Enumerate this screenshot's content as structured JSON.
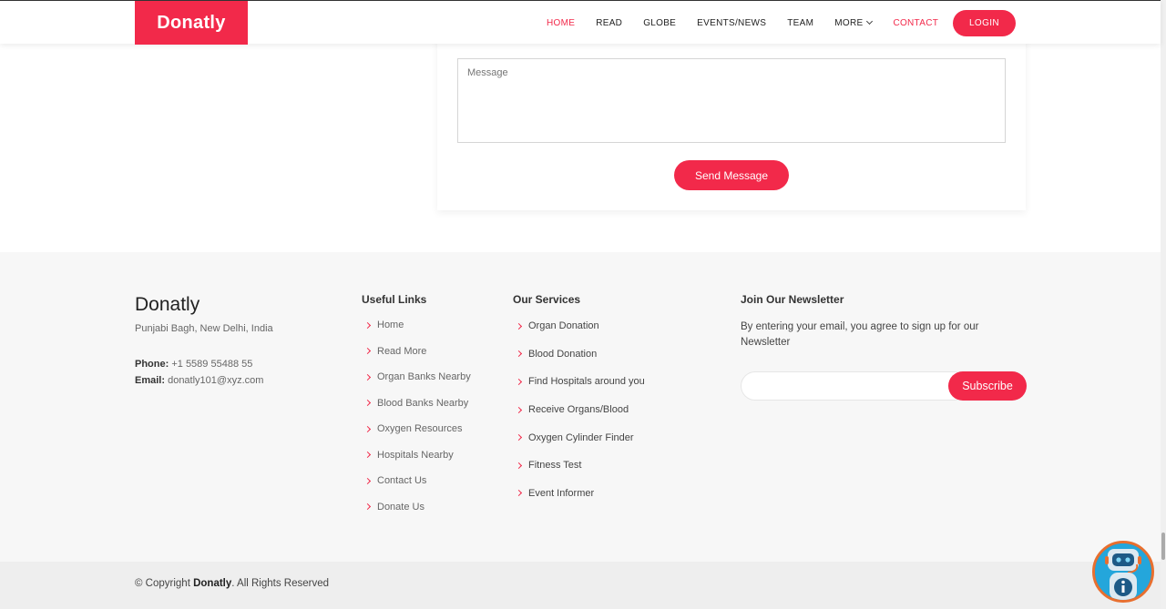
{
  "header": {
    "logo": "Donatly",
    "nav": [
      {
        "label": "HOME"
      },
      {
        "label": "READ"
      },
      {
        "label": "GLOBE"
      },
      {
        "label": "EVENTS/NEWS"
      },
      {
        "label": "TEAM"
      },
      {
        "label": "MORE"
      },
      {
        "label": "CONTACT"
      }
    ],
    "login": "LOGIN"
  },
  "contact_form": {
    "message_placeholder": "Message",
    "send_label": "Send Message"
  },
  "footer": {
    "brand": "Donatly",
    "address": "Punjabi Bagh, New Delhi, India",
    "phone_label": "Phone:",
    "phone": "+1 5589 55488 55",
    "email_label": "Email:",
    "email": "donatly101@xyz.com",
    "useful_links_title": "Useful Links",
    "useful_links": [
      "Home",
      "Read More",
      "Organ Banks Nearby",
      "Blood Banks Nearby",
      "Oxygen Resources",
      "Hospitals Nearby",
      "Contact Us",
      "Donate Us"
    ],
    "services_title": "Our Services",
    "services": [
      "Organ Donation",
      "Blood Donation",
      "Find Hospitals around you",
      "Receive Organs/Blood",
      "Oxygen Cylinder Finder",
      "Fitness Test",
      "Event Informer"
    ],
    "newsletter_title": "Join Our Newsletter",
    "newsletter_text": "By entering your email, you agree to sign up for our Newsletter",
    "subscribe_label": "Subscribe",
    "copyright_prefix": "© Copyright ",
    "copyright_brand": "Donatly",
    "copyright_suffix": ". All Rights Reserved"
  },
  "colors": {
    "accent": "#f2294a",
    "footer_bg": "#f7f7f7"
  }
}
